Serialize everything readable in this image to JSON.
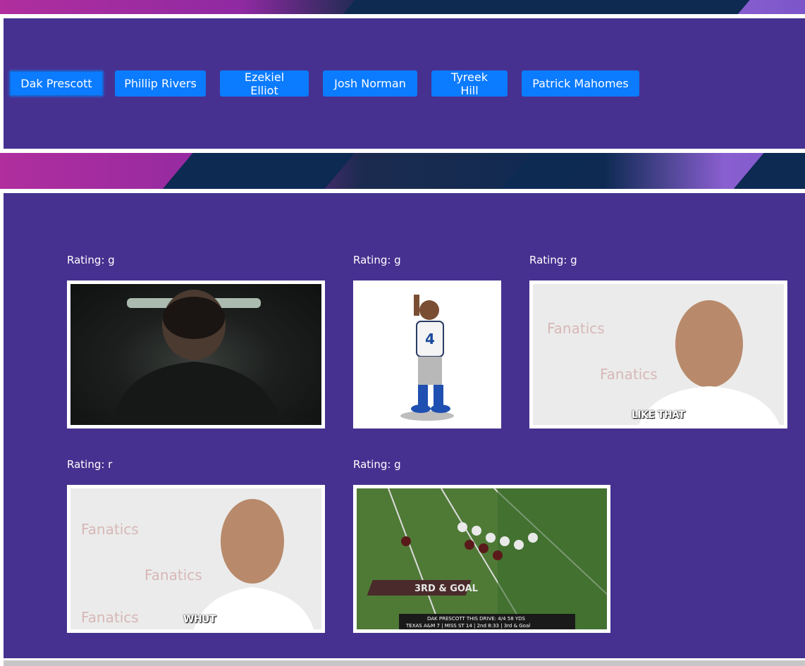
{
  "nav": {
    "buttons": [
      {
        "label": "Dak Prescott",
        "active": true
      },
      {
        "label": "Phillip Rivers",
        "active": false
      },
      {
        "label": "Ezekiel Elliot",
        "active": false
      },
      {
        "label": "Josh Norman",
        "active": false
      },
      {
        "label": "Tyreek Hill",
        "active": false
      },
      {
        "label": "Patrick Mahomes",
        "active": false
      }
    ]
  },
  "gifs": [
    {
      "rating": "Rating: g",
      "description": "player in dark room",
      "caption": ""
    },
    {
      "rating": "Rating: g",
      "description": "cartoon player number 4",
      "caption": ""
    },
    {
      "rating": "Rating: g",
      "description": "player in front of Fanatics backdrop",
      "caption": "LIKE THAT"
    },
    {
      "rating": "Rating: r",
      "description": "player in front of Fanatics backdrop",
      "caption": "WHUT"
    },
    {
      "rating": "Rating: g",
      "description": "football play 3rd & goal",
      "caption": ""
    }
  ],
  "gif_texts": {
    "jersey_number": "4",
    "fanatics": "Fanatics",
    "third_goal": "3RD & GOAL",
    "scorebug": "DAK PRESCOTT THIS DRIVE: 4/4 58 YDS",
    "score_line": "TEXAS A&M 7 | MISS ST 14 | 2nd 8:33 | 3rd & Goal"
  },
  "colors": {
    "panel": "#473190",
    "button": "#0b7bff",
    "text": "#ffffff"
  }
}
